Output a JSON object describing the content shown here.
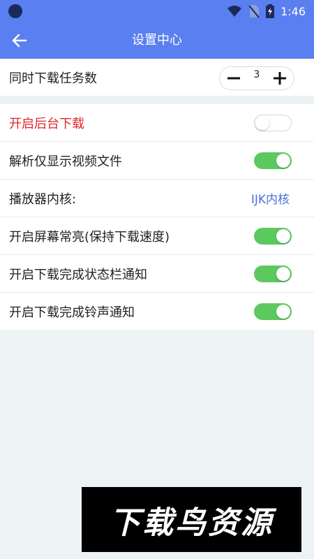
{
  "status_bar": {
    "time": "1:46",
    "icons": [
      "wifi-icon",
      "no-sim-icon",
      "battery-charging-icon"
    ]
  },
  "app_bar": {
    "title": "设置中心",
    "back_icon": "arrow-left-icon"
  },
  "settings": {
    "concurrent_downloads": {
      "label": "同时下载任务数",
      "value": "3",
      "decrement_icon": "minus-icon",
      "increment_icon": "plus-icon"
    },
    "background_download": {
      "label": "开启后台下载",
      "enabled": false,
      "label_color": "#e0262b"
    },
    "parse_video_only": {
      "label": "解析仅显示视频文件",
      "enabled": true
    },
    "player_core": {
      "label": "播放器内核:",
      "value": "IJK内核"
    },
    "keep_screen_on": {
      "label": "开启屏幕常亮(保持下载速度)",
      "enabled": true
    },
    "status_bar_notify": {
      "label": "开启下载完成状态栏通知",
      "enabled": true
    },
    "ringtone_notify": {
      "label": "开启下载完成铃声通知",
      "enabled": true
    }
  },
  "watermark": {
    "text": "下载鸟资源"
  },
  "colors": {
    "primary": "#5a7ff0",
    "toggle_on": "#5cc95f",
    "link": "#4a70d8",
    "background": "#edf3f4"
  }
}
